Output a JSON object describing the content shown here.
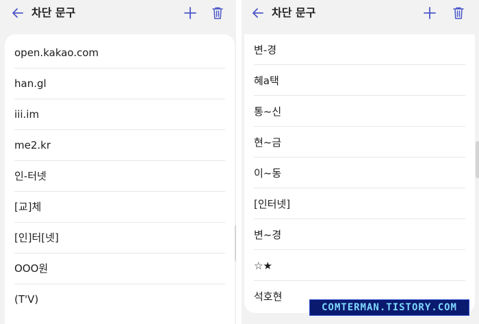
{
  "left": {
    "title": "차단 문구",
    "items": [
      "open.kakao.com",
      "han.gl",
      "iii.im",
      "me2.kr",
      "인-터넷",
      "[교]체",
      "[인]터[넷]",
      "OOO원",
      "(T'V)"
    ]
  },
  "right": {
    "title": "차단 문구",
    "items": [
      "변-경",
      "혜a택",
      "통~신",
      "현~금",
      "이~동",
      "[인터넷]",
      "변~경",
      "☆★",
      "석호현"
    ]
  },
  "icons": {
    "back": "arrow-left-icon",
    "add": "plus-icon",
    "delete": "trash-icon"
  },
  "colors": {
    "accent": "#4a56c8",
    "background": "#f2f2f2",
    "card": "#ffffff"
  },
  "watermark": "COMTERMAN.TISTORY.COM"
}
